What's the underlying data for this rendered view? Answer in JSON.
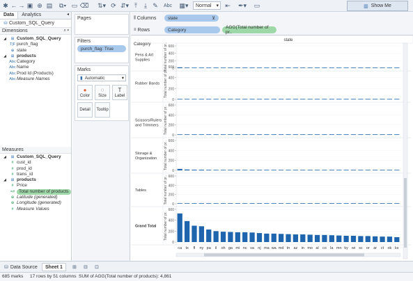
{
  "toolbar": {
    "zoom_value": "Normal",
    "show_me_label": "Show Me"
  },
  "data_pane": {
    "tabs": [
      "Data",
      "Analytics"
    ],
    "datasource": "Custom_SQL_Query",
    "dimensions_header": "Dimensions",
    "dimensions": [
      {
        "label": "Custom_SQL_Query",
        "kind": "table"
      },
      {
        "label": "purch_flag",
        "kind": "tf"
      },
      {
        "label": "state",
        "kind": "geo"
      },
      {
        "label": "products",
        "kind": "table"
      },
      {
        "label": "Category",
        "kind": "abc"
      },
      {
        "label": "Name",
        "kind": "abc"
      },
      {
        "label": "Prod Id (Products)",
        "kind": "abc"
      },
      {
        "label": "Measure Names",
        "kind": "abc"
      }
    ],
    "measures_header": "Measures",
    "measures": [
      {
        "label": "Custom_SQL_Query",
        "kind": "table"
      },
      {
        "label": "cust_id",
        "kind": "num"
      },
      {
        "label": "prod_id",
        "kind": "num"
      },
      {
        "label": "trans_id",
        "kind": "num"
      },
      {
        "label": "products",
        "kind": "table"
      },
      {
        "label": "Price",
        "kind": "num"
      },
      {
        "label": "Total number of products",
        "kind": "calc"
      },
      {
        "label": "Latitude (generated)",
        "kind": "geo"
      },
      {
        "label": "Longitude (generated)",
        "kind": "geo"
      },
      {
        "label": "Measure Values",
        "kind": "num"
      }
    ]
  },
  "cards": {
    "pages_title": "Pages",
    "filters_title": "Filters",
    "filter_pill": "purch_flag: True",
    "marks_title": "Marks",
    "mark_type": "Automatic",
    "buttons": [
      "Color",
      "Size",
      "Label",
      "Detail",
      "Tooltip"
    ]
  },
  "shelves": {
    "columns_label": "Columns",
    "rows_label": "Rows",
    "columns_pill": "state",
    "rows_pills": [
      "Category",
      "AGG(Total number of pr.."
    ]
  },
  "chart_data": {
    "type": "bar",
    "column_header": "state",
    "row_header": "Category",
    "ylabel": "Total number of pr..",
    "categories": [
      "ca",
      "tx",
      "fl",
      "ny",
      "pa",
      "il",
      "oh",
      "ga",
      "mi",
      "nc",
      "va",
      "nj",
      "ma",
      "wa",
      "md",
      "tn",
      "az",
      "in",
      "mo",
      "al",
      "co",
      "la",
      "mn",
      "ky",
      "wi",
      "sc",
      "or",
      "ar",
      "ct",
      "ok",
      "ks"
    ],
    "panes": [
      {
        "name": "Pens & Art Supplies",
        "ylim": [
          0,
          600
        ],
        "ticks": [
          0,
          200,
          400,
          600
        ],
        "values": [
          22,
          13,
          10,
          9,
          8,
          7,
          7,
          6,
          6,
          6,
          5,
          5,
          5,
          5,
          4,
          4,
          4,
          4,
          4,
          3,
          3,
          3,
          3,
          3,
          3,
          3,
          3,
          2,
          2,
          2,
          2
        ]
      },
      {
        "name": "Rubber Bands",
        "ylim": [
          0,
          600
        ],
        "ticks": [
          0,
          200,
          400,
          600
        ],
        "values": [
          4,
          2,
          2,
          2,
          2,
          1,
          1,
          1,
          1,
          1,
          1,
          1,
          1,
          1,
          1,
          1,
          1,
          1,
          1,
          1,
          1,
          1,
          1,
          1,
          1,
          1,
          1,
          1,
          1,
          1,
          1
        ]
      },
      {
        "name": "Scissors/Rulers and Trimmers",
        "ylim": [
          0,
          600
        ],
        "ticks": [
          0,
          200,
          400,
          600
        ],
        "values": [
          5,
          3,
          3,
          2,
          2,
          2,
          2,
          2,
          2,
          2,
          1,
          1,
          1,
          1,
          1,
          1,
          1,
          1,
          1,
          1,
          1,
          1,
          1,
          1,
          1,
          1,
          1,
          1,
          1,
          1,
          1
        ]
      },
      {
        "name": "Storage & Organization",
        "ylim": [
          0,
          600
        ],
        "ticks": [
          0,
          200,
          400,
          600
        ],
        "values": [
          30,
          18,
          15,
          14,
          12,
          11,
          10,
          9,
          9,
          8,
          8,
          7,
          7,
          6,
          6,
          6,
          5,
          5,
          5,
          5,
          4,
          4,
          4,
          4,
          4,
          4,
          3,
          3,
          3,
          3,
          3
        ]
      },
      {
        "name": "Tables",
        "ylim": [
          0,
          600
        ],
        "ticks": [
          0,
          200,
          400,
          600
        ],
        "values": [
          6,
          4,
          3,
          3,
          3,
          3,
          2,
          2,
          2,
          2,
          2,
          2,
          2,
          2,
          2,
          2,
          1,
          1,
          1,
          1,
          1,
          1,
          1,
          1,
          1,
          1,
          1,
          1,
          1,
          1,
          1
        ]
      },
      {
        "name": "Grand Total",
        "ylim": [
          0,
          600
        ],
        "ticks": [
          0,
          200,
          400,
          600
        ],
        "values": [
          525,
          385,
          300,
          290,
          230,
          200,
          190,
          185,
          180,
          180,
          175,
          165,
          155,
          155,
          150,
          145,
          140,
          140,
          135,
          130,
          130,
          125,
          120,
          115,
          115,
          110,
          110,
          105,
          100,
          100,
          90
        ]
      }
    ],
    "bar_color": "#1f65ad"
  },
  "sheet_bar": {
    "datasource_tab": "Data Source",
    "sheet_tab": "Sheet 1"
  },
  "status": {
    "marks": "685 marks",
    "dims": "17 rows by 51 columns",
    "sum": "SUM of AGG(Total number of products): 4,861"
  }
}
